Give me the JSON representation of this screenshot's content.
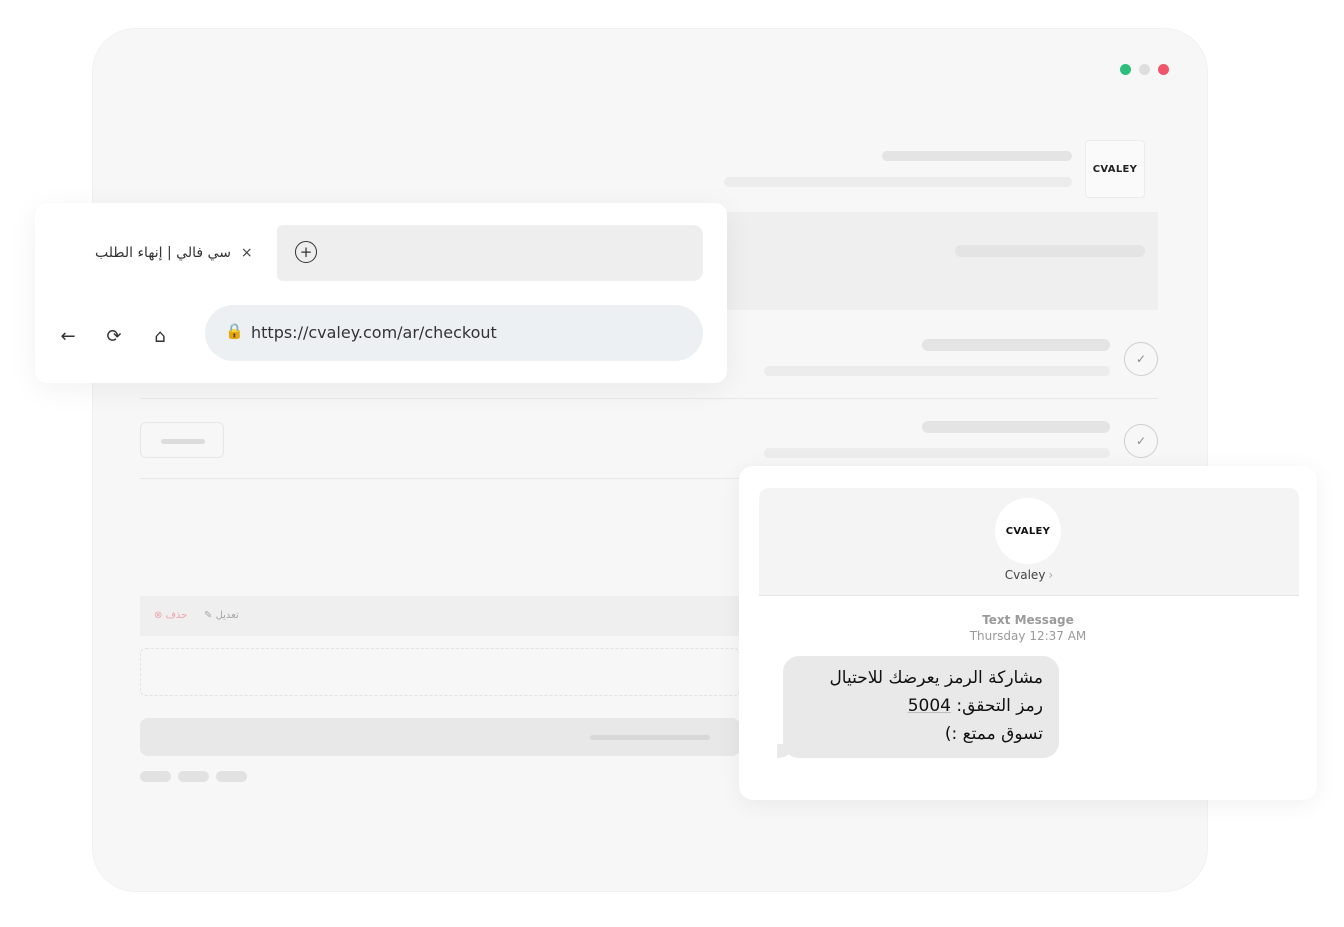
{
  "window": {
    "controls": [
      "close",
      "minimize",
      "maximize"
    ],
    "accent_colors": {
      "green": "#2bbf7b",
      "gray": "#dedede",
      "red": "#f1556b"
    }
  },
  "checkout": {
    "logo_text": "CVALEY",
    "edit_row": {
      "delete_label": "حذف",
      "edit_label": "تعديل"
    }
  },
  "browser": {
    "tab_title": "سي فالي | إنهاء الطلب",
    "close_icon": "×",
    "new_tab_icon": "+",
    "nav_icons": [
      "back-arrow-icon",
      "reload-icon",
      "home-icon"
    ],
    "url": "https://cvaley.com/ar/checkout"
  },
  "sms": {
    "avatar_text": "CVALEY",
    "sender_name": "Cvaley",
    "message_type": "Text Message",
    "timestamp": "Thursday 12:37 AM",
    "message_line1": "مشاركة الرمز يعرضك للاحتيال",
    "message_line2_prefix": "رمز التحقق: ",
    "verification_code": "5004",
    "message_line3": "تسوق ممتع :)"
  }
}
